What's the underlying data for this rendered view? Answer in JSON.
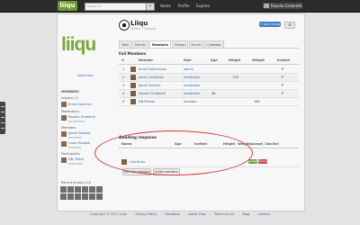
{
  "topbar": {
    "logo": "liiqu",
    "logo_badge": "beta",
    "search_placeholder": "Search for...",
    "search_button": "»",
    "nav": [
      "Home",
      "Profile",
      "Explore"
    ],
    "user_name": "Roxolia Grebelnik"
  },
  "sidebar": {
    "brand": "liiqu",
    "intro_link": "Intro Liiqu",
    "members_label": "MEMBERS",
    "admins_label": "Admins (1)",
    "admin_name": "Ernst Coorinca",
    "moderators_label": "Moderators",
    "moderator_name": "Roxolia Grebelnik",
    "moderator_sub": "moderator",
    "members_list_label": "Members",
    "member1_name": "Jamie Ferishia",
    "member1_sub": "member",
    "member2_name": "Liuuk Kivistoe",
    "member2_sub": "member",
    "participants_label": "Participants",
    "participant_name": "DB, Peliss",
    "participant_sub": "attendee",
    "photos_label": "Recent photos (12)"
  },
  "group": {
    "title": "Liiqu",
    "subtitle": "Tallinn • Estonia",
    "join_button": "+ Join Group",
    "gear": "⚙"
  },
  "tabs": [
    "Wall",
    "Events",
    "Members",
    "Photos",
    "Forum",
    "Calendar"
  ],
  "members_table": {
    "title": "Full Members",
    "headers": [
      "#",
      "Member",
      "Role",
      "Age",
      "Height",
      "Weight",
      "Invited"
    ],
    "rows": [
      {
        "num": "1",
        "name": "Ernst Fellerichsen",
        "role": "admin",
        "age": "",
        "height": "",
        "weight": "",
        "invited": "✔"
      },
      {
        "num": "2",
        "name": "Jamie Lindström",
        "role": "moderator",
        "age": "",
        "height": "178",
        "weight": "",
        "invited": "✔"
      },
      {
        "num": "3",
        "name": "Jamie Ferishia",
        "role": "moderator",
        "age": "",
        "height": "",
        "weight": "",
        "invited": "✔"
      },
      {
        "num": "4",
        "name": "Roxolia Grebelnik",
        "role": "moderator",
        "age": "28",
        "height": "",
        "weight": "",
        "invited": "✔"
      },
      {
        "num": "5",
        "name": "DB Pelisse",
        "role": "member",
        "age": "",
        "height": "180",
        "weight": "",
        "invited": ""
      }
    ]
  },
  "invites": {
    "title": "Awaiting response",
    "headers": [
      "Name",
      "Age",
      "Invited",
      "Height",
      "Weight",
      "Accept / Decline"
    ],
    "row_name": "Liisi Kivilo",
    "accept": "accept",
    "decline": "decline",
    "buttons": [
      "Add new member",
      "Invite members"
    ]
  },
  "footer": {
    "copyright": "Copyright © 2011 Liiqu",
    "links": [
      "Privacy Policy",
      "Feedback",
      "About Liiqu",
      "Terms of use",
      "Blog",
      "Contact"
    ]
  },
  "colors": {
    "brand_green": "#7aa83c",
    "annotation_red": "#d63a3a",
    "link_blue": "#2a5fa5"
  }
}
